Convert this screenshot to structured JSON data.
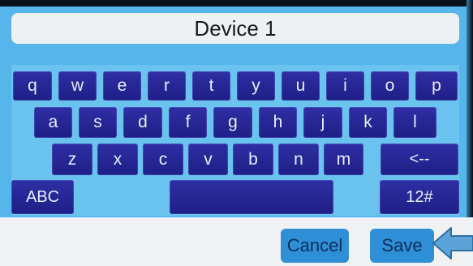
{
  "title_field": {
    "value": "Device 1"
  },
  "keyboard": {
    "row1": [
      "q",
      "w",
      "e",
      "r",
      "t",
      "y",
      "u",
      "i",
      "o",
      "p"
    ],
    "row2": [
      "a",
      "s",
      "d",
      "f",
      "g",
      "h",
      "j",
      "k",
      "l"
    ],
    "row3": [
      "z",
      "x",
      "c",
      "v",
      "b",
      "n",
      "m"
    ],
    "backspace_label": "<--",
    "mode_label": "ABC",
    "symbols_label": "12#",
    "space_label": ""
  },
  "actions": {
    "cancel_label": "Cancel",
    "save_label": "Save"
  },
  "colors": {
    "screen_bg": "#56b6ec",
    "key_bg": "#1e1f86",
    "button_bg": "#2f8fd6",
    "pointer_arrow": "#5ba3d8"
  },
  "icons": {
    "pointer": "arrow-left-icon"
  }
}
